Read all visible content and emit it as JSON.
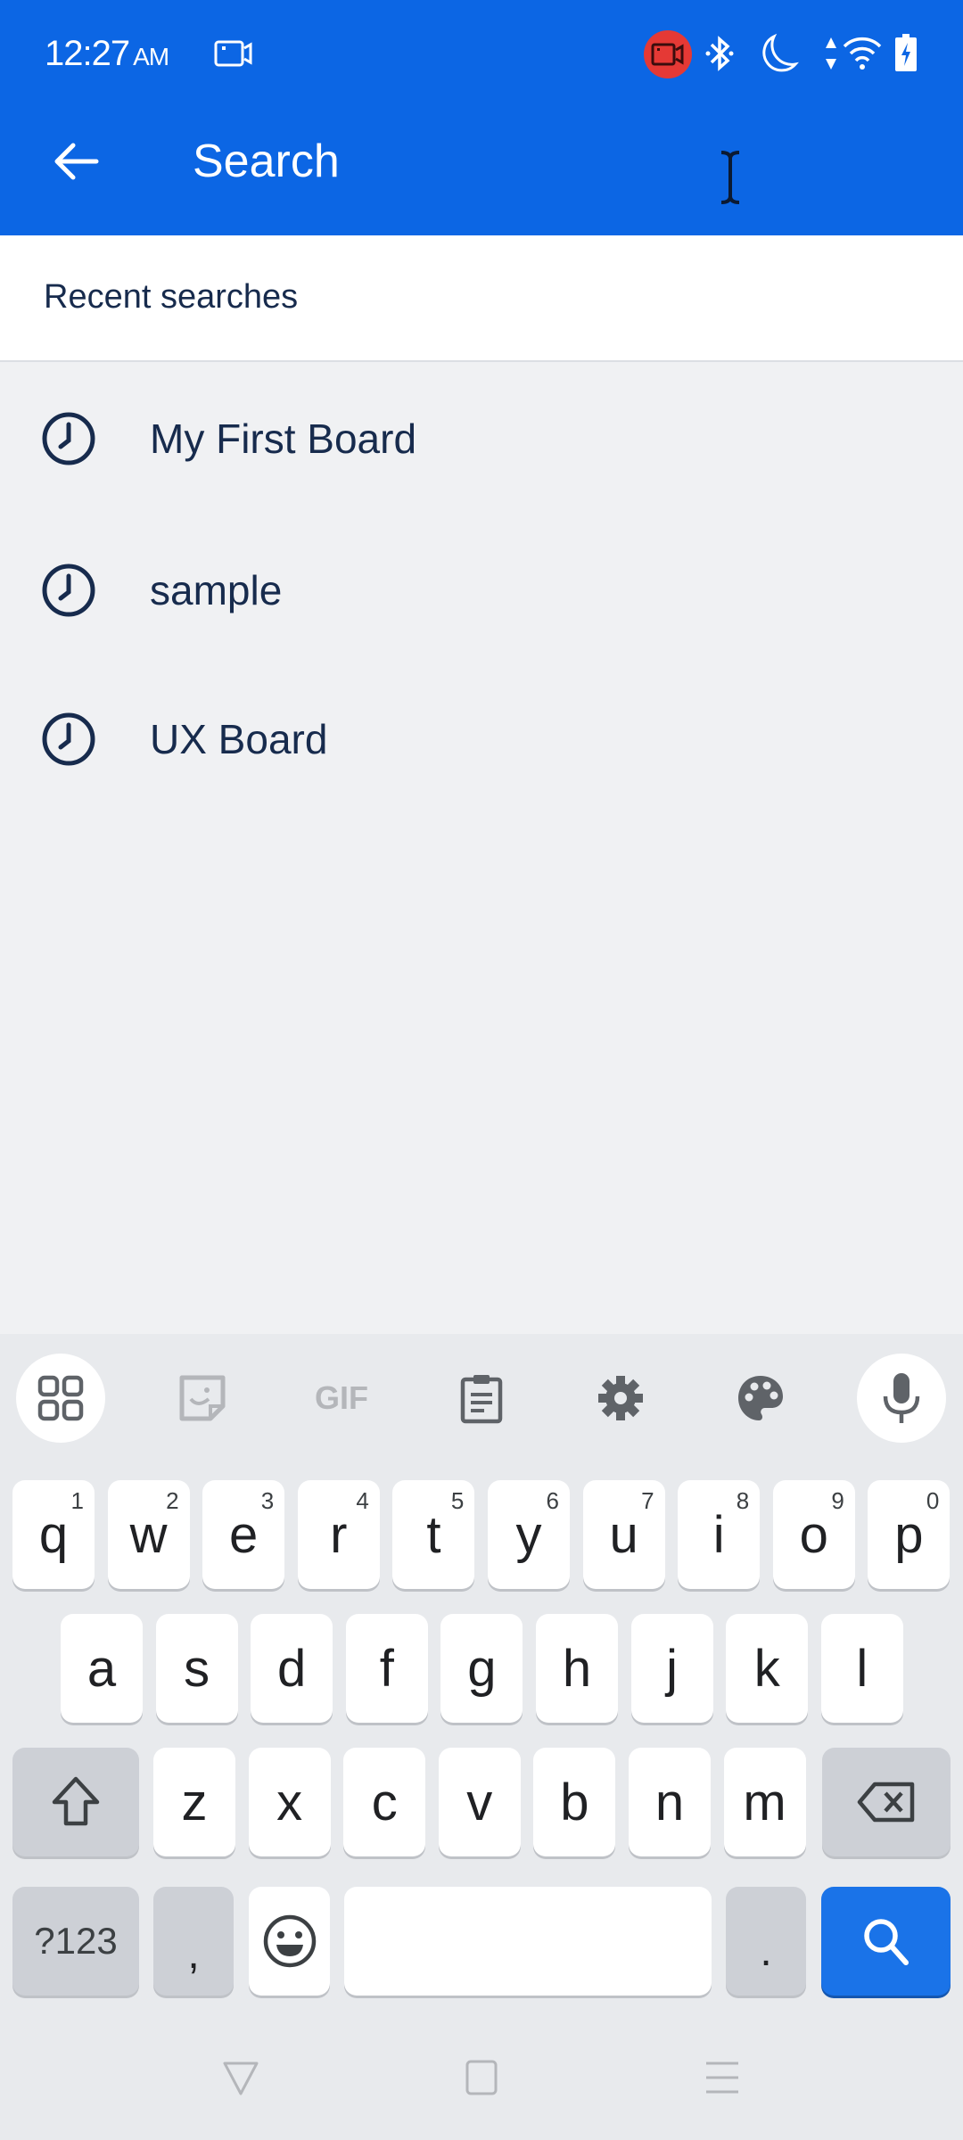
{
  "status_bar": {
    "time": "12:27",
    "ampm": "AM",
    "icons": [
      "screen-record-icon",
      "recording-indicator-icon",
      "bluetooth-icon",
      "do-not-disturb-icon",
      "data-arrows-icon",
      "wifi-icon",
      "battery-charging-icon"
    ]
  },
  "toolbar": {
    "back_icon": "arrow-left-icon",
    "title": "Search"
  },
  "recent": {
    "header": "Recent searches",
    "items": [
      {
        "icon": "clock-icon",
        "label": "My First Board"
      },
      {
        "icon": "clock-icon",
        "label": "sample"
      },
      {
        "icon": "clock-icon",
        "label": "UX Board"
      }
    ]
  },
  "keyboard": {
    "toolbar": [
      "apps-grid-icon",
      "sticker-icon",
      "gif-icon",
      "clipboard-icon",
      "settings-gear-icon",
      "palette-icon",
      "microphone-icon"
    ],
    "gif_label": "GIF",
    "row1": [
      {
        "k": "q",
        "h": "1"
      },
      {
        "k": "w",
        "h": "2"
      },
      {
        "k": "e",
        "h": "3"
      },
      {
        "k": "r",
        "h": "4"
      },
      {
        "k": "t",
        "h": "5"
      },
      {
        "k": "y",
        "h": "6"
      },
      {
        "k": "u",
        "h": "7"
      },
      {
        "k": "i",
        "h": "8"
      },
      {
        "k": "o",
        "h": "9"
      },
      {
        "k": "p",
        "h": "0"
      }
    ],
    "row2": [
      "a",
      "s",
      "d",
      "f",
      "g",
      "h",
      "j",
      "k",
      "l"
    ],
    "row3": [
      "z",
      "x",
      "c",
      "v",
      "b",
      "n",
      "m"
    ],
    "symbols_label": "?123",
    "comma": ",",
    "period": ".",
    "accent_color": "#1A73E8"
  },
  "colors": {
    "appbar": "#0C66E4",
    "text_primary": "#172B4D",
    "page_bg": "#F0F1F3"
  }
}
